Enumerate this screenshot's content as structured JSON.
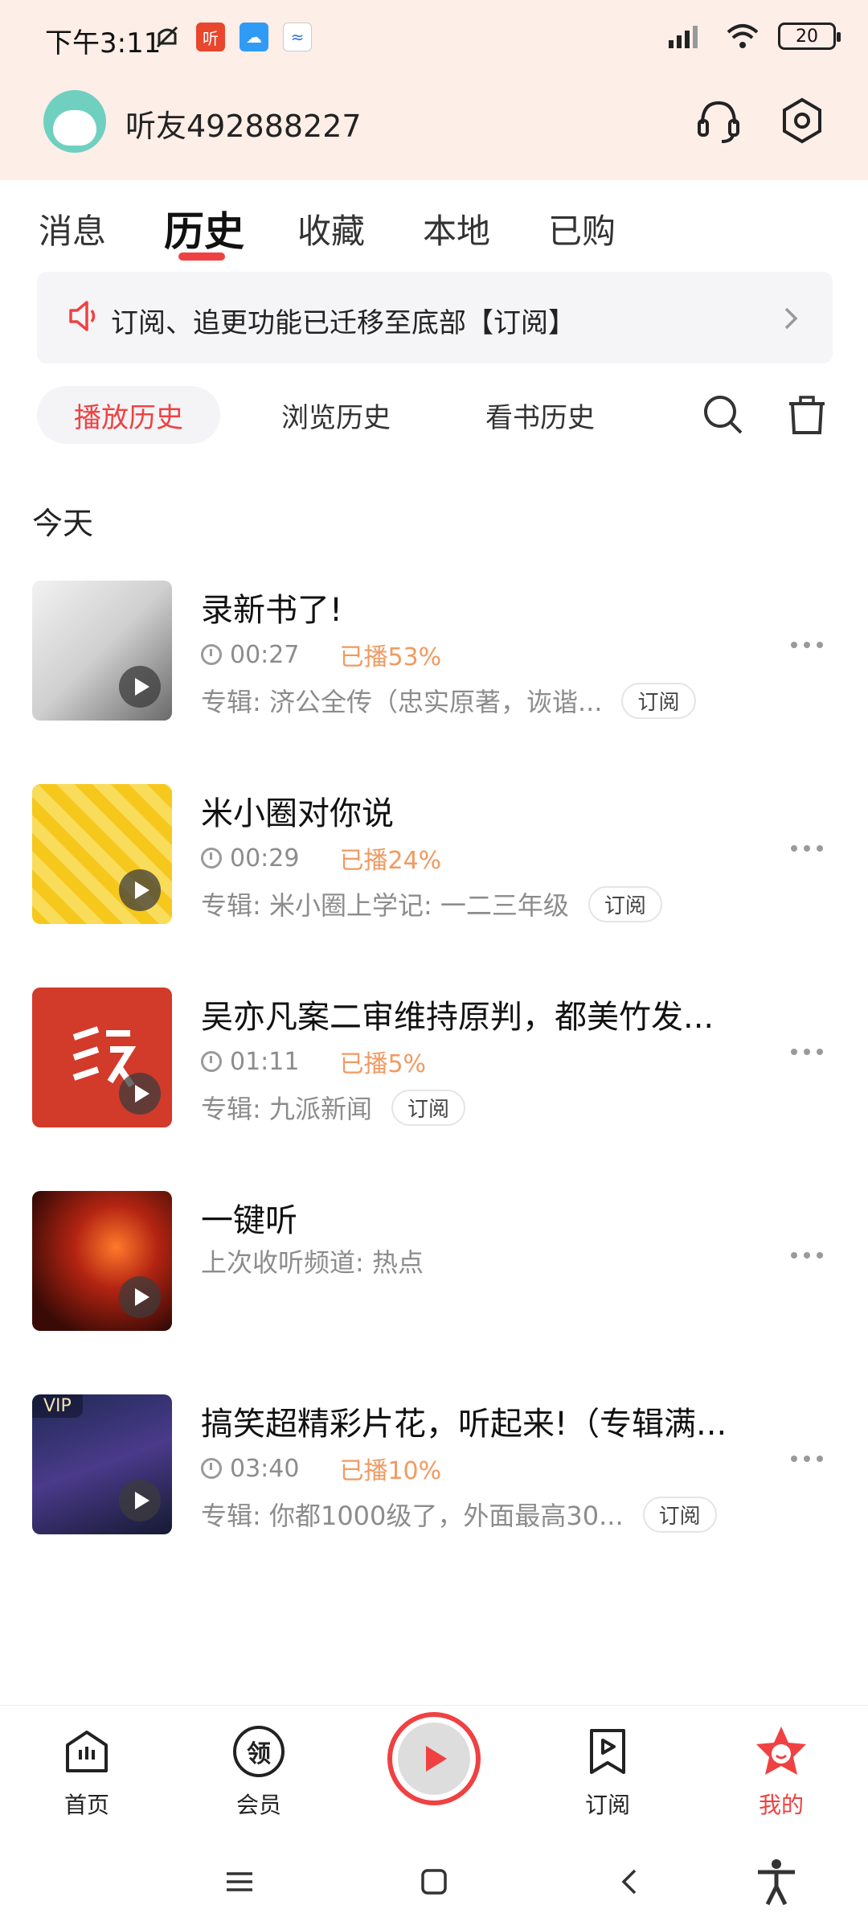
{
  "status_bar": {
    "time": "下午3:11",
    "battery": "20"
  },
  "header": {
    "username": "听友492888227"
  },
  "tabs": [
    {
      "label": "消息"
    },
    {
      "label": "历史"
    },
    {
      "label": "收藏"
    },
    {
      "label": "本地"
    },
    {
      "label": "已购"
    }
  ],
  "notice": {
    "text": "订阅、追更功能已迁移至底部【订阅】"
  },
  "filters": [
    {
      "label": "播放历史"
    },
    {
      "label": "浏览历史"
    },
    {
      "label": "看书历史"
    }
  ],
  "section_title": "今天",
  "items": [
    {
      "title": "录新书了!",
      "duration": "00:27",
      "progress": "已播53%",
      "album": "专辑: 济公全传（忠实原著，诙谐...",
      "subscribe": "订阅"
    },
    {
      "title": "米小圈对你说",
      "duration": "00:29",
      "progress": "已播24%",
      "album": "专辑: 米小圈上学记: 一二三年级",
      "subscribe": "订阅"
    },
    {
      "title": "吴亦凡案二审维持原判，都美竹发...",
      "duration": "01:11",
      "progress": "已播5%",
      "album": "专辑: 九派新闻",
      "subscribe": "订阅"
    },
    {
      "title": "一键听",
      "album": "上次收听频道: 热点"
    },
    {
      "title": "搞笑超精彩片花，听起来!（专辑满...",
      "duration": "03:40",
      "progress": "已播10%",
      "album": "专辑: 你都1000级了，外面最高30...",
      "subscribe": "订阅",
      "badge": "VIP"
    }
  ],
  "bottom_nav": [
    {
      "label": "首页"
    },
    {
      "label": "会员",
      "icon_text": "领"
    },
    {
      "label": "订阅"
    },
    {
      "label": "我的"
    }
  ],
  "colors": {
    "accent": "#f04142",
    "header_bg": "#fdeee7",
    "progress": "#f19a61"
  }
}
